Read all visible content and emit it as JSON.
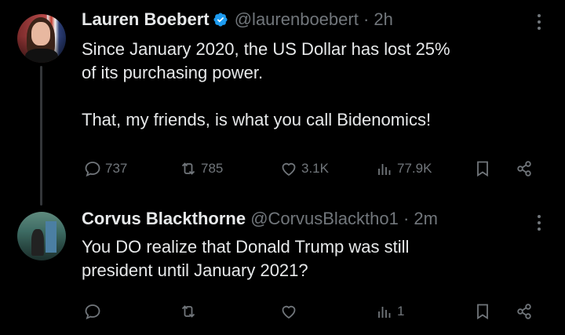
{
  "tweets": [
    {
      "name": "Lauren Boebert",
      "handle": "@laurenboebert",
      "time": "· 2h",
      "text": "Since January 2020, the US Dollar has lost 25%\nof its purchasing power.\n\nThat, my friends, is what you call Bidenomics!",
      "verified": true,
      "stats": {
        "replies": "737",
        "reposts": "785",
        "likes": "3.1K",
        "views": "77.9K"
      }
    },
    {
      "name": "Corvus Blackthorne",
      "handle": "@CorvusBlacktho1",
      "time": "· 2m",
      "text": "You DO realize that Donald Trump was still\npresident until January 2021?",
      "verified": false,
      "stats": {
        "replies": "",
        "reposts": "",
        "likes": "",
        "views": "1"
      }
    }
  ],
  "colors": {
    "background": "#000000",
    "text": "#e7e9ea",
    "muted": "#71767b",
    "verified": "#1d9bf0"
  },
  "icons": [
    "reply-icon",
    "repost-icon",
    "like-icon",
    "views-icon",
    "bookmark-icon",
    "share-icon",
    "more-icon",
    "verified-icon"
  ]
}
